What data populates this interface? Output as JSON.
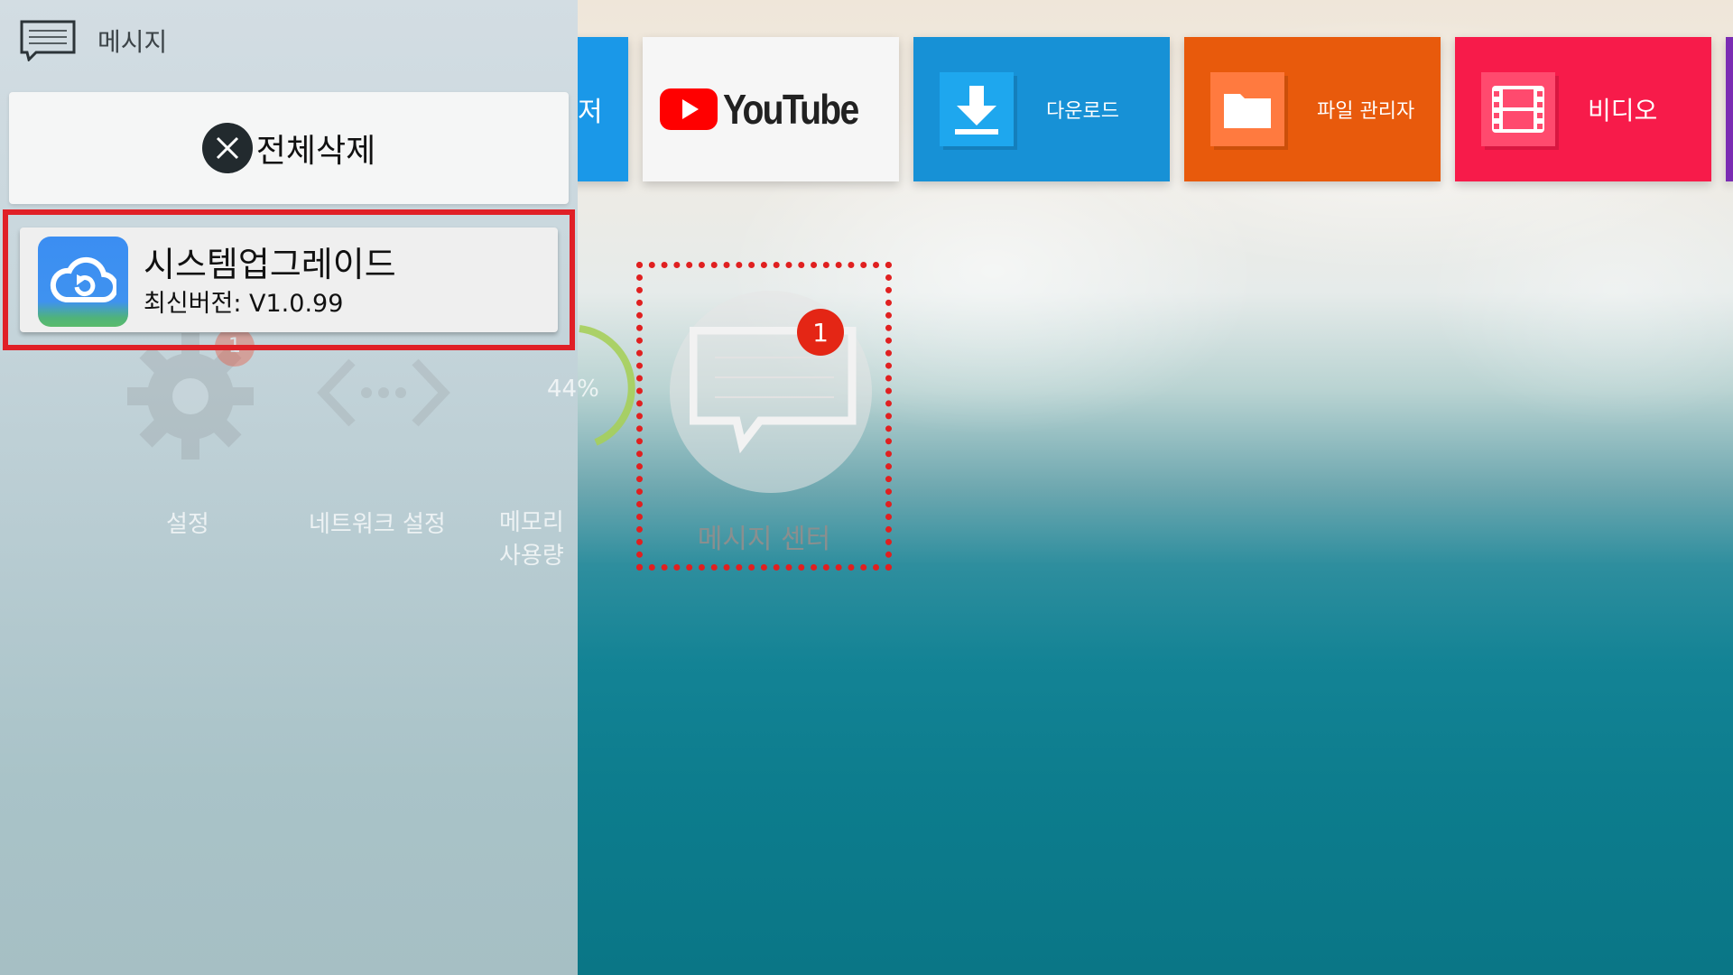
{
  "panel": {
    "title": "메시지",
    "clear_all_label": "전체삭제",
    "notification": {
      "title": "시스템업그레이드",
      "subtitle": "최신버전:  V1.0.99"
    }
  },
  "background_apps": {
    "settings_label": "설정",
    "network_label": "네트워크 설정",
    "memory_label": "메모리 사용량",
    "memory_percent": "44%",
    "memory_fraction": 0.44,
    "settings_badge": "1"
  },
  "tiles": {
    "browser_label_partial": "저",
    "youtube_label": "YouTube",
    "download_label": "다운로드",
    "files_label": "파일 관리자",
    "video_label": "비디오"
  },
  "message_center": {
    "label": "메시지 센터",
    "badge": "1"
  },
  "colors": {
    "highlight_red": "#e02027",
    "download_tile": "#1791d6",
    "files_tile": "#e85a0c",
    "video_tile": "#f71b4a",
    "youtube_red": "#ff0000"
  }
}
